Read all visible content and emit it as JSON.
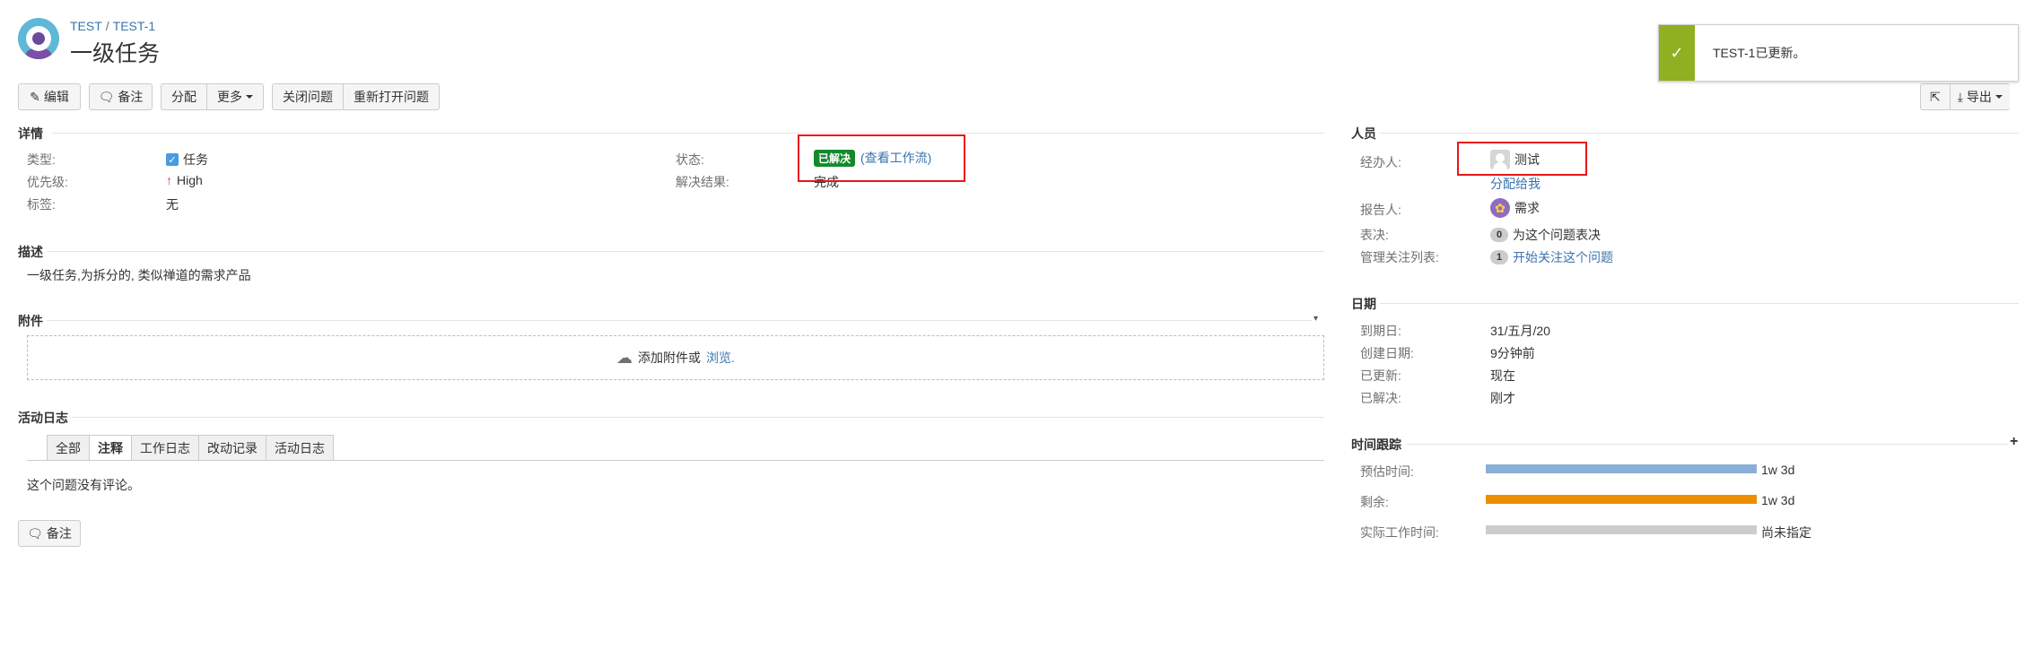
{
  "breadcrumbs": {
    "project": "TEST",
    "sep": "/",
    "issue": "TEST-1"
  },
  "issue_title": "一级任务",
  "toolbar": {
    "edit": "编辑",
    "comment": "备注",
    "assign": "分配",
    "more": "更多",
    "close_issue": "关闭问题",
    "reopen_issue": "重新打开问题"
  },
  "notification": {
    "message": "TEST-1已更新。"
  },
  "details": {
    "header": "详情",
    "type_label": "类型:",
    "type_value": "任务",
    "priority_label": "优先级:",
    "priority_value": "High",
    "labels_label": "标签:",
    "labels_value": "无",
    "status_label": "状态:",
    "status_value": "已解决",
    "workflow_link": "(查看工作流)",
    "resolution_label": "解决结果:",
    "resolution_value": "完成"
  },
  "description": {
    "header": "描述",
    "text": "一级任务,为拆分的, 类似禅道的需求产品"
  },
  "attachments": {
    "header": "附件",
    "drop_text": "添加附件或",
    "browse_link": "浏览."
  },
  "activity": {
    "header": "活动日志",
    "tabs": [
      "全部",
      "注释",
      "工作日志",
      "改动记录",
      "活动日志"
    ],
    "active_tab": 1,
    "empty_text": "这个问题没有评论。",
    "comment_button": "备注"
  },
  "people": {
    "header": "人员",
    "assignee_label": "经办人:",
    "assignee_value": "测试",
    "assign_to_me": "分配给我",
    "reporter_label": "报告人:",
    "reporter_value": "需求",
    "votes_label": "表决:",
    "votes_count": "0",
    "votes_text": "为这个问题表决",
    "watchers_label": "管理关注列表:",
    "watchers_count": "1",
    "watchers_link": "开始关注这个问题"
  },
  "dates": {
    "header": "日期",
    "due_label": "到期日:",
    "due_value": "31/五月/20",
    "created_label": "创建日期:",
    "created_value": "9分钟前",
    "updated_label": "已更新:",
    "updated_value": "现在",
    "resolved_label": "已解决:",
    "resolved_value": "刚才"
  },
  "time_tracking": {
    "header": "时间跟踪",
    "estimated_label": "预估时间:",
    "estimated_value": "1w 3d",
    "estimated_fill": 1.0,
    "remaining_label": "剩余:",
    "remaining_value": "1w 3d",
    "remaining_fill": 1.0,
    "logged_label": "实际工作时间:",
    "logged_value": "尚未指定",
    "logged_fill": 0.0
  },
  "right_toolbar": {
    "export": "导出"
  },
  "colors": {
    "link": "#3b73af",
    "status_done": "#14892c",
    "success": "#8eb021",
    "estimated_bar": "#89afd7",
    "remaining_bar": "#ec8e00",
    "empty_bar": "#cccccc",
    "highlight_box": "#e8161b"
  }
}
